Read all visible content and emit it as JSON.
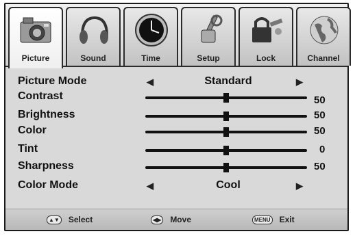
{
  "tabs": [
    {
      "label": "Picture",
      "icon": "camera-icon",
      "active": true
    },
    {
      "label": "Sound",
      "icon": "headphones-icon",
      "active": false
    },
    {
      "label": "Time",
      "icon": "clock-icon",
      "active": false
    },
    {
      "label": "Setup",
      "icon": "tools-icon",
      "active": false
    },
    {
      "label": "Lock",
      "icon": "lock-keys-icon",
      "active": false
    },
    {
      "label": "Channel",
      "icon": "globe-icon",
      "active": false
    }
  ],
  "menu": {
    "picture_mode": {
      "label": "Picture Mode",
      "value": "Standard"
    },
    "contrast": {
      "label": "Contrast",
      "value": "50",
      "level": 0.5
    },
    "brightness": {
      "label": "Brightness",
      "value": "50",
      "level": 0.5
    },
    "color": {
      "label": "Color",
      "value": "50",
      "level": 0.5
    },
    "tint": {
      "label": "Tint",
      "value": "0",
      "level": 0.5
    },
    "sharpness": {
      "label": "Sharpness",
      "value": "50",
      "level": 0.5
    },
    "color_mode": {
      "label": "Color Mode",
      "value": "Cool"
    }
  },
  "help": {
    "select_keys": "▲▼",
    "select_label": "Select",
    "move_keys": "◀▶",
    "move_label": "Move",
    "menu_key": "MENU",
    "exit_label": "Exit"
  }
}
